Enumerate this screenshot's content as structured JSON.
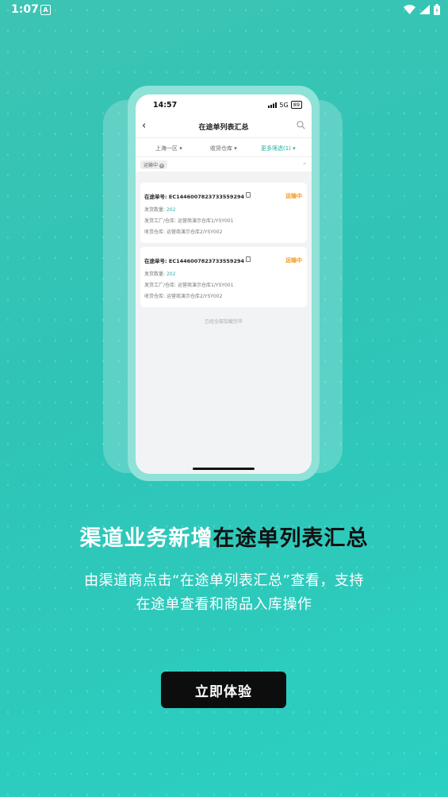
{
  "status_bar": {
    "time": "1:07",
    "indicator": "A",
    "icons": [
      "wifi-icon",
      "signal-icon",
      "battery-icon"
    ]
  },
  "preview": {
    "status_time": "14:57",
    "network": "5G",
    "battery": "89",
    "title": "在途单列表汇总",
    "filters": {
      "region": "上海一区",
      "warehouse": "收货仓库",
      "more": "更多筛选(1)"
    },
    "tag": "运输中",
    "cards": [
      {
        "number_label": "在途单号:",
        "number": "EC1446007823733559294",
        "status": "运输中",
        "qty_label": "发货数量:",
        "qty": "202",
        "origin_label": "发货工厂/仓库:",
        "origin": "运营商演示仓库1/YSY001",
        "dest_label": "收货仓库:",
        "dest": "运营商演示仓库2/YSY002"
      },
      {
        "number_label": "在途单号:",
        "number": "EC1446007823733559294",
        "status": "运输中",
        "qty_label": "发货数量:",
        "qty": "202",
        "origin_label": "发货工厂/仓库:",
        "origin": "运营商演示仓库1/YSY001",
        "dest_label": "收货仓库:",
        "dest": "运营商演示仓库2/YSY002"
      }
    ],
    "end_text": "已经全部加载完毕"
  },
  "headline": {
    "white_part": "渠道业务新增",
    "dark_part": "在途单列表汇总"
  },
  "description": {
    "line1": "由渠道商点击“在途单列表汇总”查看，支持",
    "line2": "在途单查看和商品入库操作"
  },
  "cta_label": "立即体验",
  "colors": {
    "background": "#2fc4b6",
    "accent": "#1fb3a3",
    "status_orange": "#f39b22",
    "button": "#0d0d0d"
  }
}
